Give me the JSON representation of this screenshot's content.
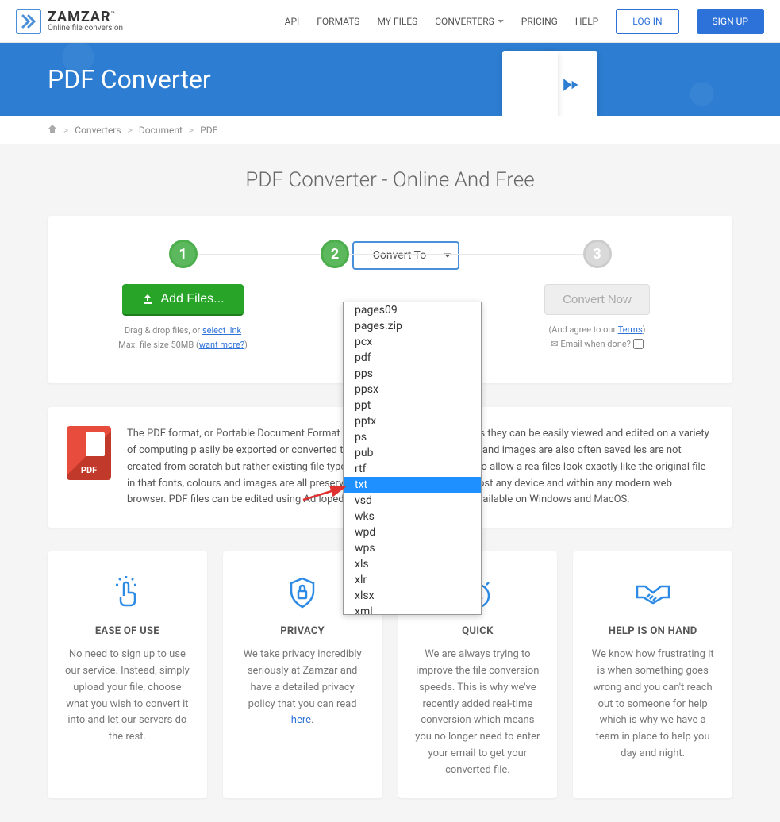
{
  "logo": {
    "main": "ZAMZAR",
    "sub": "Online file conversion",
    "tm": "™"
  },
  "nav": {
    "api": "API",
    "formats": "FORMATS",
    "myfiles": "MY FILES",
    "converters": "CONVERTERS",
    "pricing": "PRICING",
    "help": "HELP",
    "login": "LOG IN",
    "signup": "SIGN UP"
  },
  "hero": {
    "title": "PDF Converter"
  },
  "breadcrumb": {
    "converters": "Converters",
    "document": "Document",
    "pdf": "PDF"
  },
  "subtitle": "PDF Converter - Online And Free",
  "steps": {
    "one": "1",
    "two": "2",
    "three": "3",
    "add_files": "Add Files...",
    "convert_to": "Convert To",
    "convert_now": "Convert Now",
    "drag_drop": "Drag & drop files, or ",
    "select_link": "select link",
    "max_size": "Max. file size 50MB (",
    "want_more": "want more?",
    "agree_prefix": "(And agree to our ",
    "terms": "Terms",
    "agree_suffix": ")",
    "email_done": "Email when done?"
  },
  "dropdown": {
    "items": [
      "pages09",
      "pages.zip",
      "pcx",
      "pdf",
      "pps",
      "ppsx",
      "ppt",
      "pptx",
      "ps",
      "pub",
      "rtf",
      "txt",
      "vsd",
      "wks",
      "wpd",
      "wps",
      "xls",
      "xlr",
      "xlsx",
      "xml"
    ],
    "selected": "txt"
  },
  "info": {
    "badge": "PDF",
    "text": "The PDF format, or Portable Document Format                                                stems. PDF files are popular as they can be easily viewed and edited on a variety of computing p                                                asily be exported or converted to PDF, and both presentations and images are also often saved                                                     les are not created from scratch but rather existing file types are converted into the PDF to allow a rea                                               files look exactly like the original file in that fonts, colours and images are all preserved. PDF files                                                  e opened by almost any device and within any modern web browser. PDF files can be edited using Ad                                              loped almost 30 years ago and is available on Windows and MacOS."
  },
  "features": {
    "ease": {
      "title": "EASE OF USE",
      "text": "No need to sign up to use our service. Instead, simply upload your file, choose what you wish to convert it into and let our servers do the rest."
    },
    "privacy": {
      "title": "PRIVACY",
      "text_before": "We take privacy incredibly seriously at Zamzar and have a detailed privacy policy that you can read ",
      "link": "here",
      "text_after": "."
    },
    "quick": {
      "title": "QUICK",
      "text": "We are always trying to improve the file conversion speeds. This is why we've recently added real-time conversion which means you no longer need to enter your email to get your converted file."
    },
    "help": {
      "title": "HELP IS ON HAND",
      "text": "We know how frustrating it is when something goes wrong and you can't reach out to someone for help which is why we have a team in place to help you day and night."
    }
  }
}
